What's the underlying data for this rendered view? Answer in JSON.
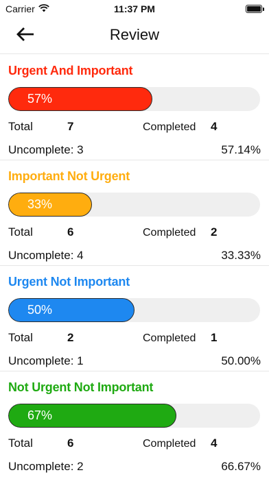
{
  "status_bar": {
    "carrier": "Carrier",
    "time": "11:37 PM"
  },
  "nav": {
    "title": "Review"
  },
  "labels": {
    "total": "Total",
    "completed": "Completed",
    "uncomplete_prefix": "Uncomplete: "
  },
  "sections": [
    {
      "title": "Urgent And Important",
      "color": "#ff2a0d",
      "progress": 0.5714,
      "progress_label": "57%",
      "total": "7",
      "completed": "4",
      "uncomplete": "3",
      "percent": "57.14%"
    },
    {
      "title": "Important Not Urgent",
      "color": "#ffad0f",
      "progress": 0.3333,
      "progress_label": "33%",
      "total": "6",
      "completed": "2",
      "uncomplete": "4",
      "percent": "33.33%"
    },
    {
      "title": "Urgent Not Important",
      "color": "#1e88f0",
      "progress": 0.5,
      "progress_label": "50%",
      "total": "2",
      "completed": "1",
      "uncomplete": "1",
      "percent": "50.00%"
    },
    {
      "title": "Not Urgent Not Important",
      "color": "#1faa12",
      "progress": 0.6667,
      "progress_label": "67%",
      "total": "6",
      "completed": "4",
      "uncomplete": "2",
      "percent": "66.67%"
    }
  ]
}
